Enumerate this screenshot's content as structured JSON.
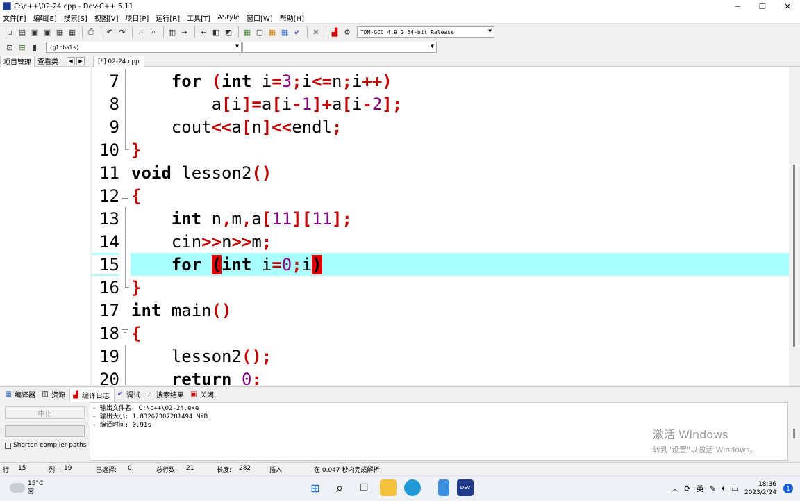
{
  "window": {
    "title": "C:\\c++\\02-24.cpp - Dev-C++ 5.11"
  },
  "menu": [
    "文件[F]",
    "编辑[E]",
    "搜索[S]",
    "视图[V]",
    "项目[P]",
    "运行[R]",
    "工具[T]",
    "AStyle",
    "窗口[W]",
    "帮助[H]"
  ],
  "toolbar": {
    "compiler_select": "TDM-GCC 4.9.2 64-bit Release",
    "scope_select": "(globals)",
    "member_select": ""
  },
  "left_panel": {
    "tabs": [
      "项目管理",
      "查看类"
    ]
  },
  "editor": {
    "tab_label": "[*] 02-24.cpp",
    "line_numbers": [
      "7",
      "8",
      "9",
      "10",
      "11",
      "12",
      "13",
      "14",
      "15",
      "16",
      "17",
      "18",
      "19",
      "20"
    ]
  },
  "bottom_tabs": [
    "编译器",
    "资源",
    "编译日志",
    "调试",
    "搜索结果",
    "关闭"
  ],
  "compile": {
    "abort_label": "中止",
    "shorten_label": "Shorten compiler paths",
    "log": [
      "- 输出文件名: C:\\c++\\02-24.exe",
      "- 输出大小: 1.83267307281494 MiB",
      "- 编译时间: 0.91s"
    ]
  },
  "watermark": {
    "line1": "激活 Windows",
    "line2": "转到\"设置\"以激活 Windows。"
  },
  "status": {
    "line_label": "行:",
    "line_value": "15",
    "col_label": "列:",
    "col_value": "19",
    "sel_label": "已选择:",
    "sel_value": "0",
    "total_label": "总行数:",
    "total_value": "21",
    "len_label": "长度:",
    "len_value": "282",
    "mode": "插入",
    "message": "在 0.047 秒内完成解析"
  },
  "taskbar": {
    "temperature": "15°C",
    "weather": "雾",
    "ime": "英",
    "time": "18:36",
    "date": "2023/2/24",
    "notifications": "1"
  }
}
